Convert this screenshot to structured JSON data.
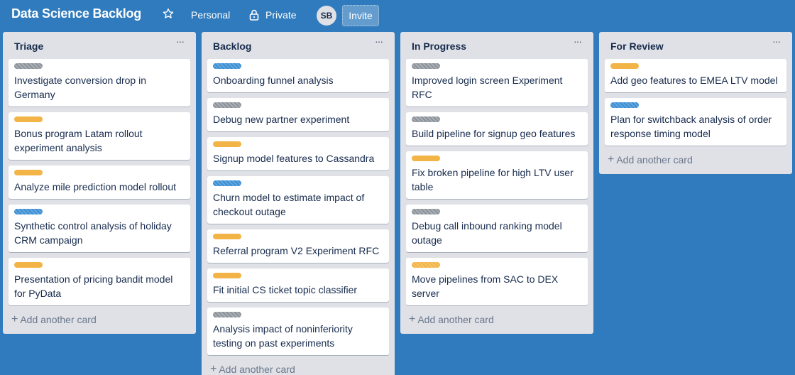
{
  "header": {
    "board_title": "Data Science Backlog",
    "star_icon": "star-outline-icon",
    "team_label": "Personal",
    "visibility_label": "Private",
    "avatar_initials": "SB",
    "invite_label": "Invite"
  },
  "colors": {
    "background": "#2f7bbd",
    "list_bg": "#dfe1e6",
    "label_orange": "#f2b447",
    "label_blue": "#3b8ed4",
    "label_gray": "#8a9199"
  },
  "add_card_label": "Add another card",
  "lists": [
    {
      "title": "Triage",
      "cards": [
        {
          "label": "gray",
          "title": "Investigate conversion drop in Germany"
        },
        {
          "label": "orange",
          "title": "Bonus program Latam rollout experiment analysis"
        },
        {
          "label": "orange",
          "title": "Analyze mile prediction model rollout"
        },
        {
          "label": "blue",
          "title": "Synthetic control analysis of holiday CRM campaign"
        },
        {
          "label": "orange",
          "title": "Presentation of pricing bandit model for PyData"
        }
      ]
    },
    {
      "title": "Backlog",
      "cards": [
        {
          "label": "blue",
          "title": "Onboarding funnel analysis"
        },
        {
          "label": "gray",
          "title": "Debug new partner experiment"
        },
        {
          "label": "orange",
          "title": "Signup model features to Cassandra"
        },
        {
          "label": "blue",
          "title": "Churn model to estimate impact of checkout outage"
        },
        {
          "label": "orange",
          "title": "Referral program V2 Experiment RFC"
        },
        {
          "label": "orange",
          "title": "Fit initial CS ticket topic classifier"
        },
        {
          "label": "gray",
          "title": "Analysis impact of noninferiority testing on past experiments"
        }
      ]
    },
    {
      "title": "In Progress",
      "cards": [
        {
          "label": "gray",
          "title": "Improved login screen Experiment RFC"
        },
        {
          "label": "gray",
          "title": "Build pipeline for signup geo features"
        },
        {
          "label": "orange",
          "title": "Fix broken pipeline for high LTV user table"
        },
        {
          "label": "gray",
          "title": "Debug call inbound ranking model outage"
        },
        {
          "label": "orange-striped",
          "title": "Move pipelines from SAC to DEX server"
        }
      ]
    },
    {
      "title": "For Review",
      "cards": [
        {
          "label": "orange",
          "title": "Add geo features to EMEA LTV model"
        },
        {
          "label": "blue",
          "title": "Plan for switchback analysis of order response timing model"
        }
      ]
    }
  ]
}
